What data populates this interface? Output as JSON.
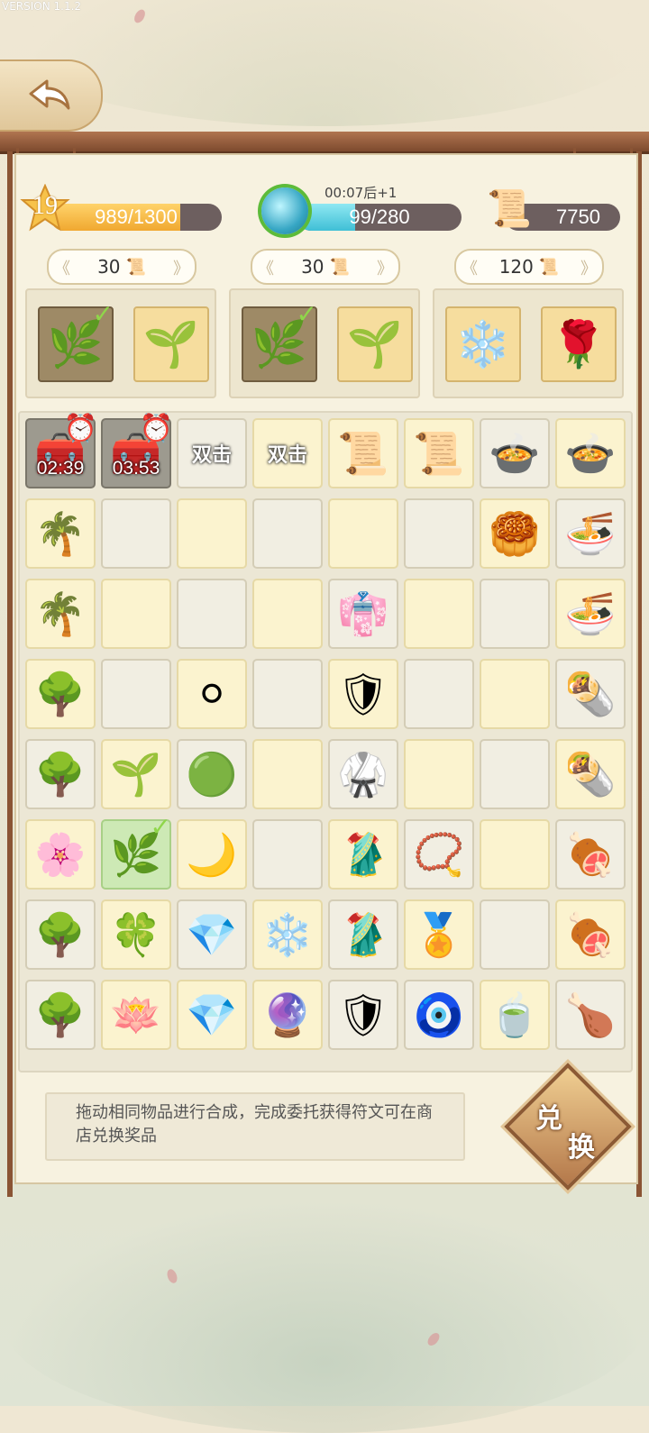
{
  "version": "VERSION 1.1.2",
  "player": {
    "level": "19",
    "xp": "989/1300",
    "xp_fraction": 0.76
  },
  "energy": {
    "timer": "00:07后+1",
    "value": "99/280",
    "fraction": 0.354
  },
  "currency": {
    "value": "7750",
    "icon": "scroll-icon"
  },
  "orders": [
    {
      "cost": "30",
      "items": [
        {
          "icon": "green-vine-icon",
          "status": "done"
        },
        {
          "icon": "green-sprout-icon",
          "status": "needed"
        }
      ]
    },
    {
      "cost": "30",
      "items": [
        {
          "icon": "green-vine-icon",
          "status": "done"
        },
        {
          "icon": "green-sprout-icon",
          "status": "needed"
        }
      ]
    },
    {
      "cost": "120",
      "items": [
        {
          "icon": "snowflake-icon",
          "status": "needed"
        },
        {
          "icon": "red-rose-icon",
          "status": "needed"
        }
      ]
    }
  ],
  "board": [
    [
      {
        "icon": "treasure-chest-icon",
        "glyph": "🧰",
        "bg": "locked",
        "timer": "02:39"
      },
      {
        "icon": "treasure-chest-icon",
        "glyph": "🧰",
        "bg": "locked",
        "timer": "03:53"
      },
      {
        "icon": "double-hit-locked-chest-icon",
        "label": "双击",
        "bg": "grey"
      },
      {
        "icon": "double-hit-chest-icon",
        "label": "双击",
        "bg": "yellow"
      },
      {
        "icon": "scroll-stack-icon",
        "glyph": "📜",
        "bg": "yellow"
      },
      {
        "icon": "scroll-sword-icon",
        "glyph": "📜",
        "bg": "yellow"
      },
      {
        "icon": "soup-bowl-icon",
        "glyph": "🍲",
        "bg": "grey"
      },
      {
        "icon": "soup-bowl-icon",
        "glyph": "🍲",
        "bg": "yellow"
      }
    ],
    [
      {
        "icon": "flower-tree-icon",
        "glyph": "🌴",
        "bg": "yellow"
      },
      {
        "bg": "grey"
      },
      {
        "bg": "yellow"
      },
      {
        "bg": "grey"
      },
      {
        "bg": "yellow"
      },
      {
        "bg": "grey"
      },
      {
        "icon": "mooncake-icon",
        "glyph": "🥮",
        "bg": "yellow"
      },
      {
        "icon": "noodle-bowl-icon",
        "glyph": "🍜",
        "bg": "grey"
      }
    ],
    [
      {
        "icon": "flower-tree-icon",
        "glyph": "🌴",
        "bg": "yellow"
      },
      {
        "bg": "yellow"
      },
      {
        "bg": "grey"
      },
      {
        "bg": "yellow"
      },
      {
        "icon": "purple-robe-icon",
        "glyph": "👘",
        "bg": "grey"
      },
      {
        "bg": "yellow"
      },
      {
        "bg": "grey"
      },
      {
        "icon": "noodle-bowl-icon",
        "glyph": "🍜",
        "bg": "yellow"
      }
    ],
    [
      {
        "icon": "red-blossom-tree-icon",
        "glyph": "🌳",
        "bg": "yellow"
      },
      {
        "bg": "grey"
      },
      {
        "icon": "pearl-icon",
        "glyph": "⚪",
        "bg": "yellow"
      },
      {
        "bg": "grey"
      },
      {
        "icon": "blue-armor-icon",
        "glyph": "🛡",
        "bg": "yellow"
      },
      {
        "bg": "grey"
      },
      {
        "bg": "yellow"
      },
      {
        "icon": "wrap-roll-icon",
        "glyph": "🌯",
        "bg": "grey"
      }
    ],
    [
      {
        "icon": "red-blossom-tree-icon",
        "glyph": "🌳",
        "bg": "grey"
      },
      {
        "icon": "green-sprout-icon",
        "glyph": "🌱",
        "bg": "yellow"
      },
      {
        "icon": "green-jade-icon",
        "glyph": "🟢",
        "bg": "grey"
      },
      {
        "bg": "yellow"
      },
      {
        "icon": "green-armor-icon",
        "glyph": "🥋",
        "bg": "grey"
      },
      {
        "bg": "yellow"
      },
      {
        "bg": "grey"
      },
      {
        "icon": "wrap-roll-icon",
        "glyph": "🌯",
        "bg": "yellow"
      }
    ],
    [
      {
        "icon": "pink-blossom-tree-icon",
        "glyph": "🌸",
        "bg": "yellow"
      },
      {
        "icon": "green-vine-icon",
        "glyph": "🌿",
        "bg": "green",
        "check": true
      },
      {
        "icon": "crescent-moon-icon",
        "glyph": "🌙",
        "bg": "yellow"
      },
      {
        "bg": "grey"
      },
      {
        "icon": "gold-armor-icon",
        "glyph": "🥻",
        "bg": "yellow"
      },
      {
        "icon": "jade-pendant-icon",
        "glyph": "📿",
        "bg": "grey"
      },
      {
        "bg": "yellow"
      },
      {
        "icon": "roast-ribs-icon",
        "glyph": "🍖",
        "bg": "grey"
      }
    ],
    [
      {
        "icon": "purple-willow-tree-icon",
        "glyph": "🌳",
        "bg": "grey"
      },
      {
        "icon": "four-leaf-clover-icon",
        "glyph": "🍀",
        "bg": "yellow"
      },
      {
        "icon": "blue-crystal-icon",
        "glyph": "💎",
        "bg": "grey"
      },
      {
        "icon": "snowflake-icon",
        "glyph": "❄️",
        "bg": "yellow"
      },
      {
        "icon": "purple-armor-icon",
        "glyph": "🥻",
        "bg": "grey"
      },
      {
        "icon": "gold-amulet-icon",
        "glyph": "🏅",
        "bg": "yellow"
      },
      {
        "bg": "grey"
      },
      {
        "icon": "roast-ribs-icon",
        "glyph": "🍖",
        "bg": "yellow"
      }
    ],
    [
      {
        "icon": "purple-willow-tree-icon",
        "glyph": "🌳",
        "bg": "grey"
      },
      {
        "icon": "lotus-flower-icon",
        "glyph": "🪷",
        "bg": "yellow"
      },
      {
        "icon": "blue-crystal-icon",
        "glyph": "💎",
        "bg": "yellow"
      },
      {
        "icon": "pink-crystal-icon",
        "glyph": "🔮",
        "bg": "yellow"
      },
      {
        "icon": "silver-armor-icon",
        "glyph": "🛡",
        "bg": "grey"
      },
      {
        "icon": "turquoise-pendant-icon",
        "glyph": "🧿",
        "bg": "grey"
      },
      {
        "icon": "tea-bowl-icon",
        "glyph": "🍵",
        "bg": "yellow"
      },
      {
        "icon": "roast-chicken-icon",
        "glyph": "🍗",
        "bg": "grey"
      }
    ]
  ],
  "tip": "拖动相同物品进行合成，完成委托获得符文可在商店兑换奖品",
  "exchange_button": {
    "line1": "兑",
    "line2": "换"
  }
}
